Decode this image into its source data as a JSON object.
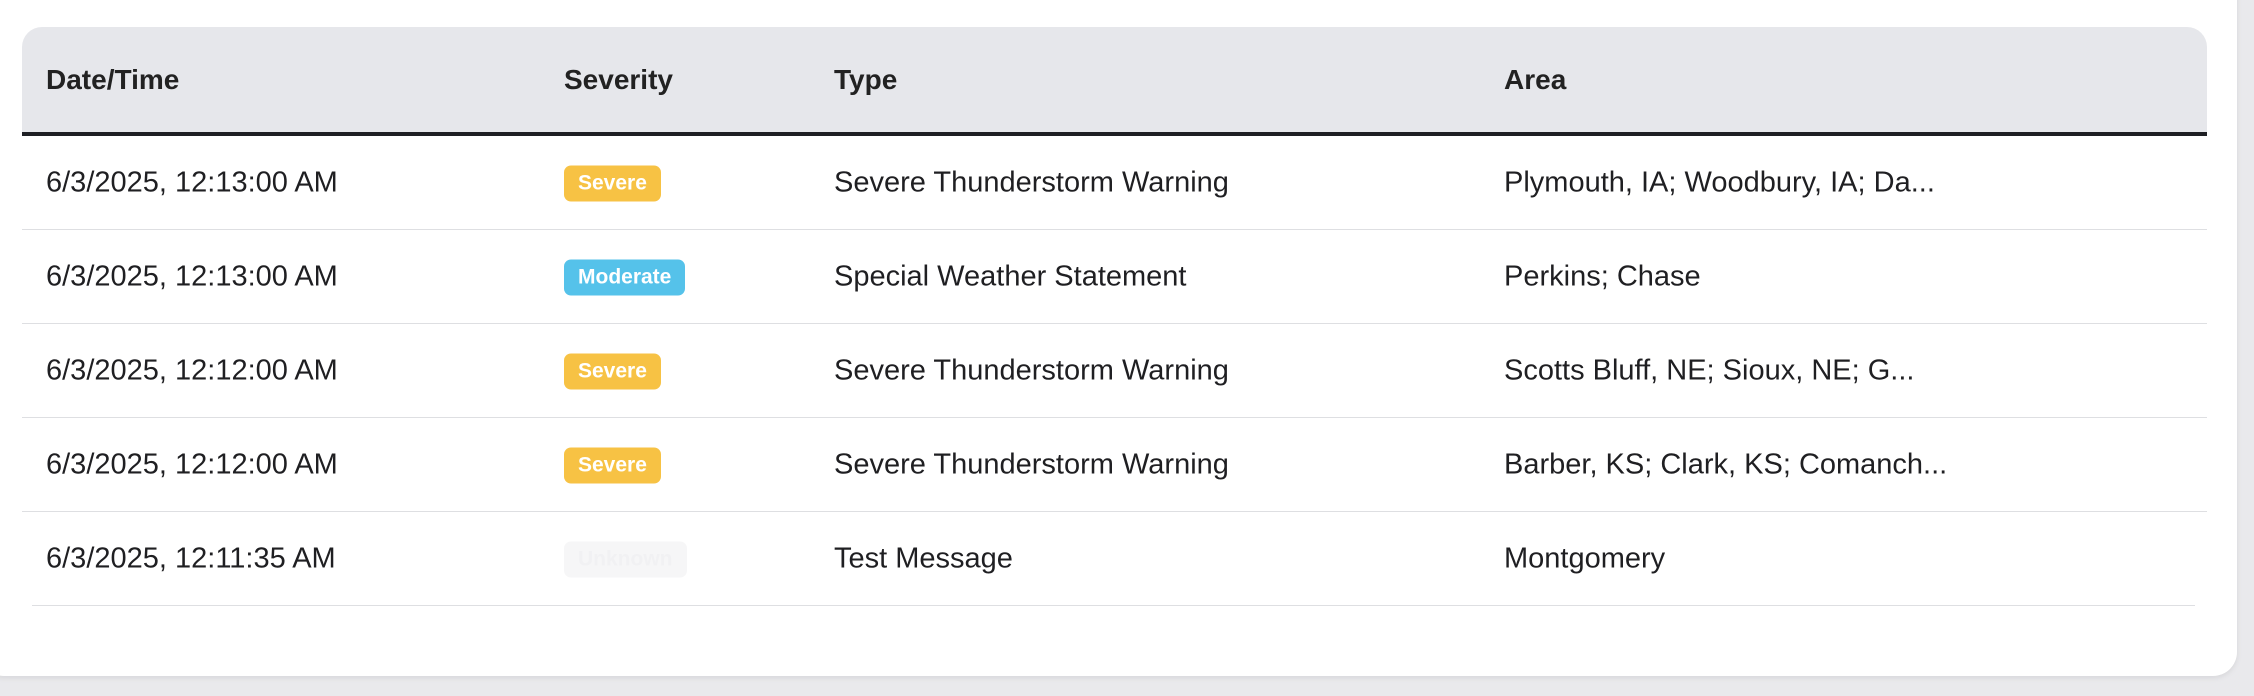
{
  "table": {
    "columns": [
      "Date/Time",
      "Severity",
      "Type",
      "Area"
    ],
    "rows": [
      {
        "datetime": "6/3/2025, 12:13:00 AM",
        "severity": "Severe",
        "type": "Severe Thunderstorm Warning",
        "area": "Plymouth, IA; Woodbury, IA; Da..."
      },
      {
        "datetime": "6/3/2025, 12:13:00 AM",
        "severity": "Moderate",
        "type": "Special Weather Statement",
        "area": "Perkins; Chase"
      },
      {
        "datetime": "6/3/2025, 12:12:00 AM",
        "severity": "Severe",
        "type": "Severe Thunderstorm Warning",
        "area": "Scotts Bluff, NE; Sioux, NE; G..."
      },
      {
        "datetime": "6/3/2025, 12:12:00 AM",
        "severity": "Severe",
        "type": "Severe Thunderstorm Warning",
        "area": "Barber, KS; Clark, KS; Comanch..."
      },
      {
        "datetime": "6/3/2025, 12:11:35 AM",
        "severity": "Unknown",
        "type": "Test Message",
        "area": "Montgomery"
      }
    ]
  },
  "colors": {
    "severe": "#f7c244",
    "moderate": "#55c2ea",
    "unknown": "#f6f6f7",
    "header_bg": "#e6e7eb"
  }
}
